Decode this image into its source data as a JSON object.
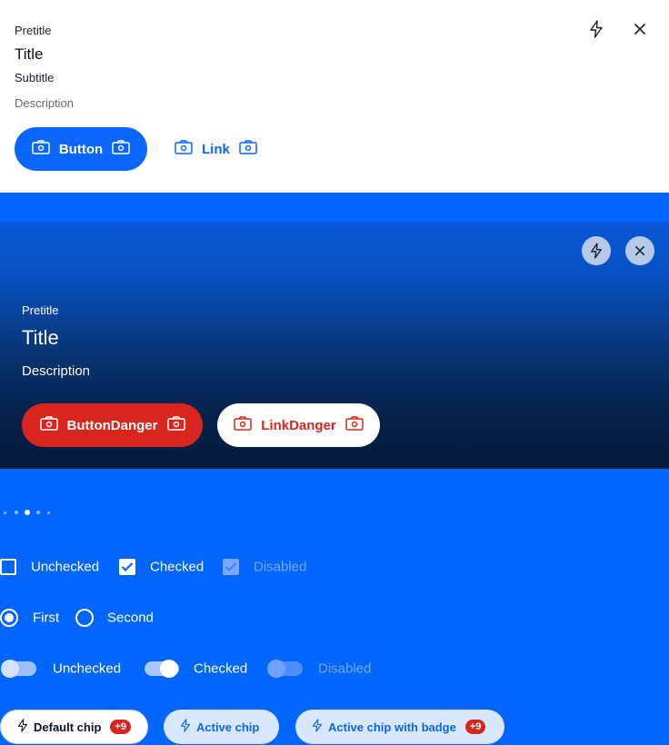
{
  "card1": {
    "pretitle": "Pretitle",
    "title": "Title",
    "subtitle": "Subtitle",
    "description": "Description",
    "button_label": "Button",
    "link_label": "Link"
  },
  "card2": {
    "pretitle": "Pretitle",
    "title": "Title",
    "description": "Description",
    "button_danger_label": "ButtonDanger",
    "link_danger_label": "LinkDanger"
  },
  "pagination": {
    "count": 5,
    "active_index": 2
  },
  "checkboxes": [
    {
      "label": "Unchecked",
      "state": "unchecked"
    },
    {
      "label": "Checked",
      "state": "checked"
    },
    {
      "label": "Disabled",
      "state": "disabled-checked"
    }
  ],
  "radios": [
    {
      "label": "First",
      "selected": true
    },
    {
      "label": "Second",
      "selected": false
    }
  ],
  "switches": [
    {
      "label": "Unchecked",
      "state": "off"
    },
    {
      "label": "Checked",
      "state": "on"
    },
    {
      "label": "Disabled",
      "state": "disabled"
    }
  ],
  "chips": [
    {
      "label": "Default chip",
      "badge": "+9",
      "variant": "default"
    },
    {
      "label": "Active chip",
      "badge": "",
      "variant": "active"
    },
    {
      "label": "Active chip with badge",
      "badge": "+9",
      "variant": "active"
    }
  ],
  "colors": {
    "brand": "#0066ff",
    "primary_button": "#0a66ff",
    "danger": "#d8261f",
    "white": "#ffffff"
  },
  "icons": [
    "camera-icon",
    "lightning-icon",
    "close-icon",
    "check-icon"
  ]
}
